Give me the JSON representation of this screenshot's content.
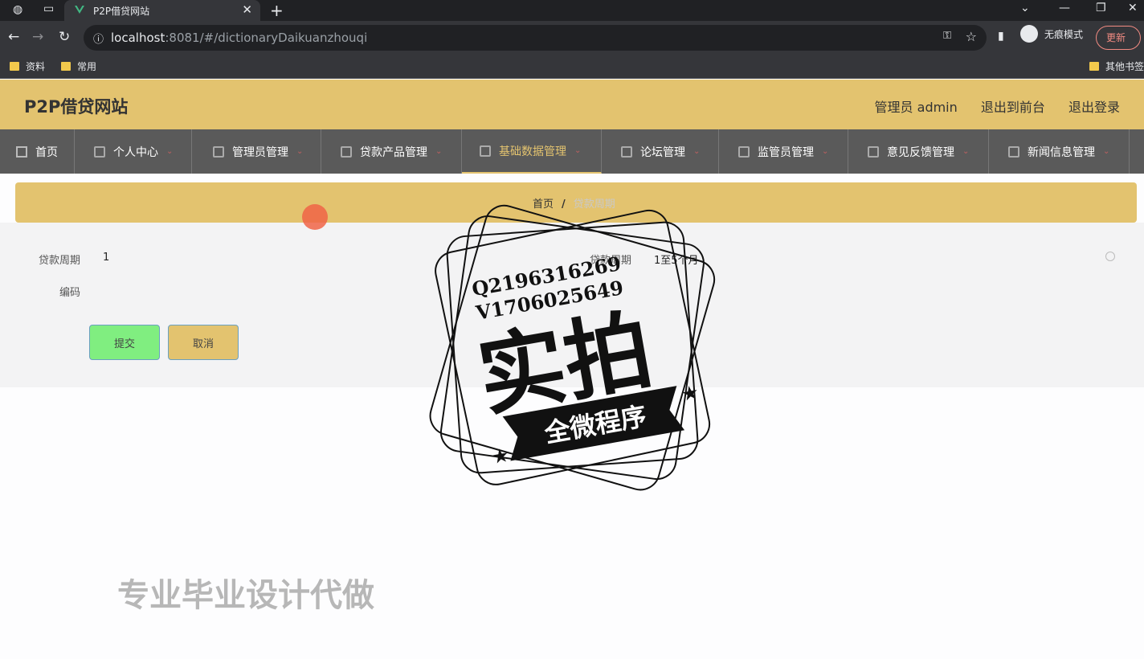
{
  "browser": {
    "tab_title": "P2P借贷网站",
    "tab_close": "✕",
    "new_tab": "+",
    "url_host": "localhost",
    "url_rest": ":8081/#/dictionaryDaikuanzhouqi",
    "incognito_label": "无痕模式",
    "update_label": "更新",
    "bookmarks": [
      "资料",
      "常用"
    ],
    "other_bookmarks": "其他书签"
  },
  "header": {
    "site_title": "P2P借贷网站",
    "user_label": "管理员 admin",
    "to_front": "退出到前台",
    "logout": "退出登录"
  },
  "nav": {
    "items": [
      {
        "label": "首页"
      },
      {
        "label": "个人中心"
      },
      {
        "label": "管理员管理"
      },
      {
        "label": "贷款产品管理"
      },
      {
        "label": "基础数据管理"
      },
      {
        "label": "论坛管理"
      },
      {
        "label": "监管员管理"
      },
      {
        "label": "意见反馈管理"
      },
      {
        "label": "新闻信息管理"
      }
    ],
    "active_index": 4
  },
  "breadcrumb": {
    "home": "首页",
    "sep": "/",
    "current": "贷款周期"
  },
  "form": {
    "field1_label": "贷款周期",
    "field1_value": "1",
    "field2_label": "贷款周期",
    "field2_value": "1至5个月",
    "field3_label": "编码",
    "submit_label": "提交",
    "cancel_label": "取消"
  },
  "overlay": {
    "stamp_line1": "Q2196316269",
    "stamp_line2": "V1706025649",
    "stamp_main": "实拍",
    "stamp_ribbon": "全微程序",
    "promo": "专业毕业设计代做"
  }
}
